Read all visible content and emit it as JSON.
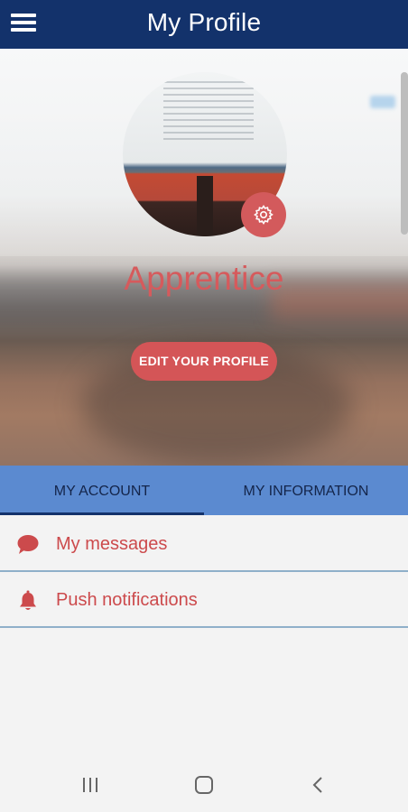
{
  "appbar": {
    "title": "My Profile",
    "menu_icon": "hamburger-menu-icon"
  },
  "profile": {
    "username": "Apprentice",
    "edit_button": "EDIT YOUR PROFILE",
    "settings_icon": "gear-icon"
  },
  "tabs": [
    {
      "label": "MY ACCOUNT",
      "selected": true
    },
    {
      "label": "MY INFORMATION",
      "selected": false
    }
  ],
  "menu": [
    {
      "label": "My messages",
      "icon": "chat-bubble-icon"
    },
    {
      "label": "Push notifications",
      "icon": "bell-icon"
    }
  ],
  "colors": {
    "appbar": "#13326b",
    "accent": "#d45557",
    "tab_bar": "#5b8ad0",
    "list_text": "#cc4a4c"
  },
  "system_nav": [
    "recent-apps-icon",
    "home-icon",
    "back-icon"
  ]
}
